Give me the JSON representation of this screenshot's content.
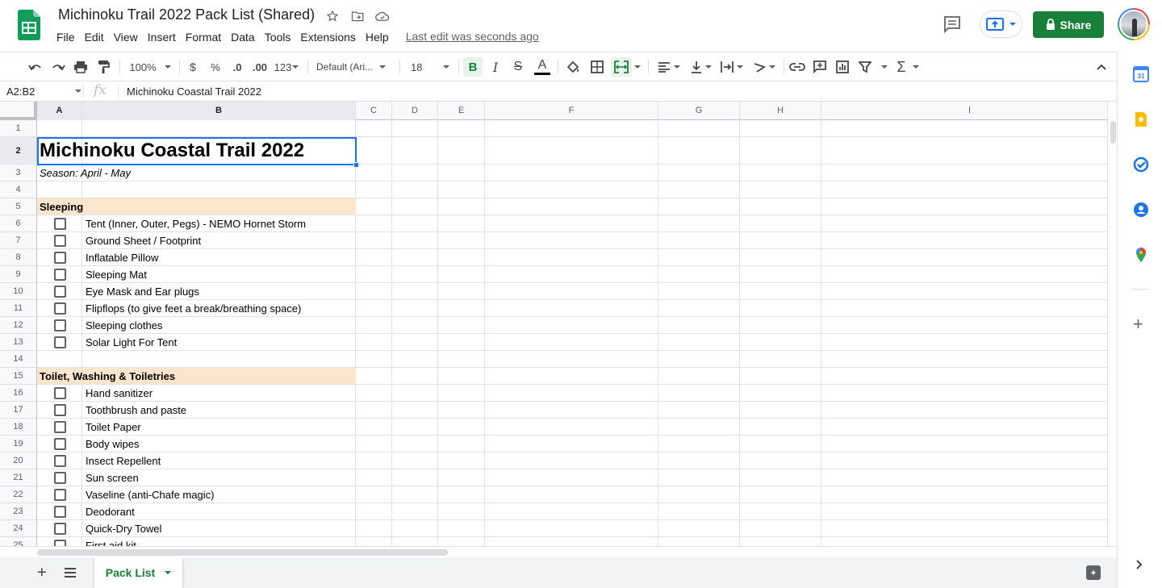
{
  "document": {
    "title": "Michinoku Trail 2022 Pack List (Shared)",
    "last_edit": "Last edit was seconds ago"
  },
  "menu": [
    "File",
    "Edit",
    "View",
    "Insert",
    "Format",
    "Data",
    "Tools",
    "Extensions",
    "Help"
  ],
  "header_actions": {
    "share_label": "Share"
  },
  "toolbar": {
    "zoom": "100%",
    "currency": "$",
    "percent": "%",
    "decrease_decimal": ".0",
    "increase_decimal": ".00",
    "more_formats": "123",
    "font": "Default (Ari...",
    "font_size": "18",
    "bold": "B",
    "italic": "I",
    "strike": "S",
    "text_color_glyph": "A"
  },
  "formula_bar": {
    "name_box": "A2:B2",
    "fx": "fx",
    "content": "Michinoku Coastal Trail 2022"
  },
  "columns": [
    "A",
    "B",
    "C",
    "D",
    "E",
    "F",
    "G",
    "H",
    "I"
  ],
  "rows": [
    {
      "num": "1"
    },
    {
      "num": "2",
      "type": "title",
      "text": "Michinoku Coastal Trail 2022"
    },
    {
      "num": "3",
      "type": "subtitle",
      "text": "Season: April - May"
    },
    {
      "num": "4"
    },
    {
      "num": "5",
      "type": "section",
      "text": "Sleeping"
    },
    {
      "num": "6",
      "type": "item",
      "text": "Tent (Inner, Outer, Pegs) - NEMO Hornet Storm",
      "checked": false
    },
    {
      "num": "7",
      "type": "item",
      "text": "Ground Sheet / Footprint",
      "checked": false
    },
    {
      "num": "8",
      "type": "item",
      "text": "Inflatable Pillow",
      "checked": false
    },
    {
      "num": "9",
      "type": "item",
      "text": "Sleeping Mat",
      "checked": false
    },
    {
      "num": "10",
      "type": "item",
      "text": "Eye Mask and Ear plugs",
      "checked": false
    },
    {
      "num": "11",
      "type": "item",
      "text": "Flipflops (to give feet a break/breathing space)",
      "checked": false
    },
    {
      "num": "12",
      "type": "item",
      "text": "Sleeping clothes",
      "checked": false
    },
    {
      "num": "13",
      "type": "item",
      "text": "Solar Light For Tent",
      "checked": false
    },
    {
      "num": "14"
    },
    {
      "num": "15",
      "type": "section",
      "text": "Toilet, Washing & Toiletries"
    },
    {
      "num": "16",
      "type": "item",
      "text": "Hand sanitizer",
      "checked": false
    },
    {
      "num": "17",
      "type": "item",
      "text": "Toothbrush and paste",
      "checked": false
    },
    {
      "num": "18",
      "type": "item",
      "text": "Toilet Paper",
      "checked": false
    },
    {
      "num": "19",
      "type": "item",
      "text": "Body wipes",
      "checked": false
    },
    {
      "num": "20",
      "type": "item",
      "text": "Insect Repellent",
      "checked": false
    },
    {
      "num": "21",
      "type": "item",
      "text": "Sun screen",
      "checked": false
    },
    {
      "num": "22",
      "type": "item",
      "text": "Vaseline (anti-Chafe magic)",
      "checked": false
    },
    {
      "num": "23",
      "type": "item",
      "text": "Deodorant",
      "checked": false
    },
    {
      "num": "24",
      "type": "item",
      "text": "Quick-Dry Towel",
      "checked": false
    },
    {
      "num": "25",
      "type": "item",
      "text": "First aid kit",
      "checked": false
    }
  ],
  "sheet_tabs": [
    {
      "label": "Pack List",
      "active": true
    }
  ],
  "side_panel": [
    "calendar-icon",
    "keep-icon",
    "tasks-icon",
    "contacts-icon",
    "maps-icon"
  ],
  "colors": {
    "brand_green": "#188038",
    "section_fill": "#fce5cd",
    "selection_blue": "#1a73e8"
  }
}
